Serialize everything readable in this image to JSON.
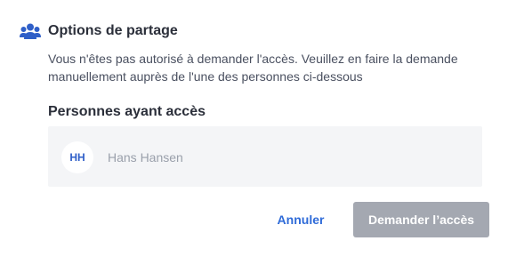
{
  "dialog": {
    "icon": "users-icon",
    "title": "Options de partage",
    "message_line1": "Vous n'êtes pas autorisé à demander l'accès. Veuillez en faire la demande",
    "message_line2": "manuellement auprès de l'une des personnes ci-dessous"
  },
  "access": {
    "section_title": "Personnes ayant accès",
    "people": [
      {
        "initials": "HH",
        "name": "Hans Hansen"
      }
    ]
  },
  "buttons": {
    "cancel_label": "Annuler",
    "request_label": "Demander l’accès"
  },
  "colors": {
    "accent": "#2f6bd8",
    "icon": "#2f5fc8",
    "disabled_button": "#a4a8b1",
    "people_box_bg": "#f4f5f7"
  }
}
